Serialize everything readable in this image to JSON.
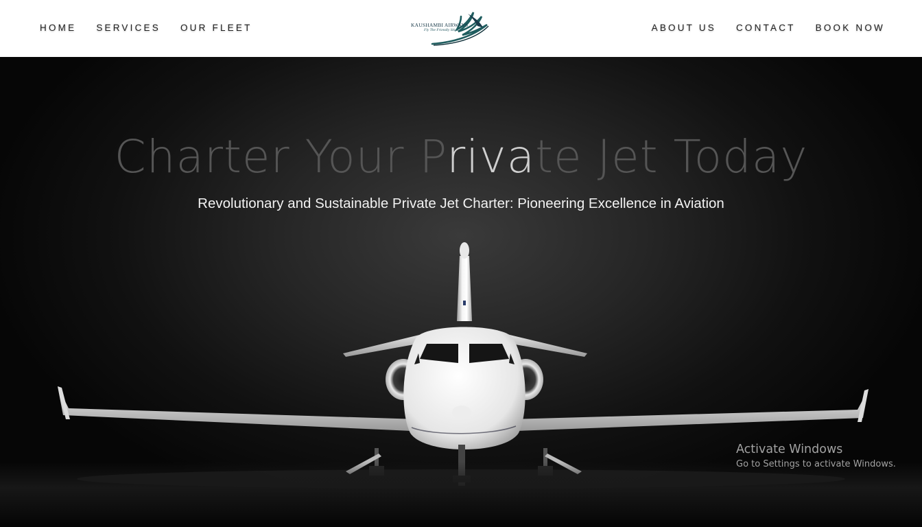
{
  "nav": {
    "left": [
      "HOME",
      "SERVICES",
      "OUR FLEET"
    ],
    "right": [
      "ABOUT US",
      "CONTACT",
      "BOOK NOW"
    ]
  },
  "logo": {
    "name": "KAUSHAMBI AIRWAYS",
    "tagline": "Fly The Friendly Skies"
  },
  "hero": {
    "title_part1": "Charter Your P",
    "title_highlight": "riva",
    "title_part2": "te Jet Today",
    "subtitle": "Revolutionary and Sustainable Private Jet Charter: Pioneering Excellence in Aviation"
  },
  "watermark": {
    "title": "Activate Windows",
    "subtitle": "Go to Settings to activate Windows."
  },
  "colors": {
    "header_bg": "#ffffff",
    "hero_bg": "#1a1a1a",
    "logo_accent": "#1f5d5f"
  }
}
